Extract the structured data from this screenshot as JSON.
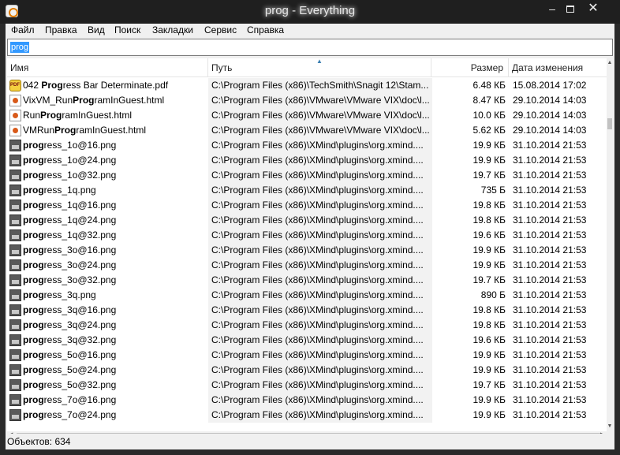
{
  "window": {
    "title": "prog - Everything",
    "minimize": "–",
    "close": "✕"
  },
  "menu": [
    "Файл",
    "Правка",
    "Вид",
    "Поиск",
    "Закладки",
    "Сервис",
    "Справка"
  ],
  "search": {
    "value": "prog"
  },
  "columns": {
    "name": "Имя",
    "path": "Путь",
    "size": "Размер",
    "date": "Дата изменения"
  },
  "rows": [
    {
      "icon": "pdf-icon",
      "pre": "042 ",
      "hl": "Prog",
      "suf": "ress Bar Determinate.pdf",
      "path": "C:\\Program Files (x86)\\TechSmith\\Snagit 12\\Stam...",
      "size": "6.48 КБ",
      "date": "15.08.2014 17:02"
    },
    {
      "icon": "html-icon",
      "pre": "VixVM_Run",
      "hl": "Prog",
      "suf": "ramInGuest.html",
      "path": "C:\\Program Files (x86)\\VMware\\VMware VIX\\doc\\l...",
      "size": "8.47 КБ",
      "date": "29.10.2014 14:03"
    },
    {
      "icon": "html-icon",
      "pre": "Run",
      "hl": "Prog",
      "suf": "ramInGuest.html",
      "path": "C:\\Program Files (x86)\\VMware\\VMware VIX\\doc\\l...",
      "size": "10.0 КБ",
      "date": "29.10.2014 14:03"
    },
    {
      "icon": "html-icon",
      "pre": "VMRun",
      "hl": "Prog",
      "suf": "ramInGuest.html",
      "path": "C:\\Program Files (x86)\\VMware\\VMware VIX\\doc\\l...",
      "size": "5.62 КБ",
      "date": "29.10.2014 14:03"
    },
    {
      "icon": "png-icon",
      "pre": "",
      "hl": "prog",
      "suf": "ress_1o@16.png",
      "path": "C:\\Program Files (x86)\\XMind\\plugins\\org.xmind....",
      "size": "19.9 КБ",
      "date": "31.10.2014 21:53"
    },
    {
      "icon": "png-icon",
      "pre": "",
      "hl": "prog",
      "suf": "ress_1o@24.png",
      "path": "C:\\Program Files (x86)\\XMind\\plugins\\org.xmind....",
      "size": "19.9 КБ",
      "date": "31.10.2014 21:53"
    },
    {
      "icon": "png-icon",
      "pre": "",
      "hl": "prog",
      "suf": "ress_1o@32.png",
      "path": "C:\\Program Files (x86)\\XMind\\plugins\\org.xmind....",
      "size": "19.7 КБ",
      "date": "31.10.2014 21:53"
    },
    {
      "icon": "png-icon",
      "pre": "",
      "hl": "prog",
      "suf": "ress_1q.png",
      "path": "C:\\Program Files (x86)\\XMind\\plugins\\org.xmind....",
      "size": "735 Б",
      "date": "31.10.2014 21:53"
    },
    {
      "icon": "png-icon",
      "pre": "",
      "hl": "prog",
      "suf": "ress_1q@16.png",
      "path": "C:\\Program Files (x86)\\XMind\\plugins\\org.xmind....",
      "size": "19.8 КБ",
      "date": "31.10.2014 21:53"
    },
    {
      "icon": "png-icon",
      "pre": "",
      "hl": "prog",
      "suf": "ress_1q@24.png",
      "path": "C:\\Program Files (x86)\\XMind\\plugins\\org.xmind....",
      "size": "19.8 КБ",
      "date": "31.10.2014 21:53"
    },
    {
      "icon": "png-icon",
      "pre": "",
      "hl": "prog",
      "suf": "ress_1q@32.png",
      "path": "C:\\Program Files (x86)\\XMind\\plugins\\org.xmind....",
      "size": "19.6 КБ",
      "date": "31.10.2014 21:53"
    },
    {
      "icon": "png-icon",
      "pre": "",
      "hl": "prog",
      "suf": "ress_3o@16.png",
      "path": "C:\\Program Files (x86)\\XMind\\plugins\\org.xmind....",
      "size": "19.9 КБ",
      "date": "31.10.2014 21:53"
    },
    {
      "icon": "png-icon",
      "pre": "",
      "hl": "prog",
      "suf": "ress_3o@24.png",
      "path": "C:\\Program Files (x86)\\XMind\\plugins\\org.xmind....",
      "size": "19.9 КБ",
      "date": "31.10.2014 21:53"
    },
    {
      "icon": "png-icon",
      "pre": "",
      "hl": "prog",
      "suf": "ress_3o@32.png",
      "path": "C:\\Program Files (x86)\\XMind\\plugins\\org.xmind....",
      "size": "19.7 КБ",
      "date": "31.10.2014 21:53"
    },
    {
      "icon": "png-icon",
      "pre": "",
      "hl": "prog",
      "suf": "ress_3q.png",
      "path": "C:\\Program Files (x86)\\XMind\\plugins\\org.xmind....",
      "size": "890 Б",
      "date": "31.10.2014 21:53"
    },
    {
      "icon": "png-icon",
      "pre": "",
      "hl": "prog",
      "suf": "ress_3q@16.png",
      "path": "C:\\Program Files (x86)\\XMind\\plugins\\org.xmind....",
      "size": "19.8 КБ",
      "date": "31.10.2014 21:53"
    },
    {
      "icon": "png-icon",
      "pre": "",
      "hl": "prog",
      "suf": "ress_3q@24.png",
      "path": "C:\\Program Files (x86)\\XMind\\plugins\\org.xmind....",
      "size": "19.8 КБ",
      "date": "31.10.2014 21:53"
    },
    {
      "icon": "png-icon",
      "pre": "",
      "hl": "prog",
      "suf": "ress_3q@32.png",
      "path": "C:\\Program Files (x86)\\XMind\\plugins\\org.xmind....",
      "size": "19.6 КБ",
      "date": "31.10.2014 21:53"
    },
    {
      "icon": "png-icon",
      "pre": "",
      "hl": "prog",
      "suf": "ress_5o@16.png",
      "path": "C:\\Program Files (x86)\\XMind\\plugins\\org.xmind....",
      "size": "19.9 КБ",
      "date": "31.10.2014 21:53"
    },
    {
      "icon": "png-icon",
      "pre": "",
      "hl": "prog",
      "suf": "ress_5o@24.png",
      "path": "C:\\Program Files (x86)\\XMind\\plugins\\org.xmind....",
      "size": "19.9 КБ",
      "date": "31.10.2014 21:53"
    },
    {
      "icon": "png-icon",
      "pre": "",
      "hl": "prog",
      "suf": "ress_5o@32.png",
      "path": "C:\\Program Files (x86)\\XMind\\plugins\\org.xmind....",
      "size": "19.7 КБ",
      "date": "31.10.2014 21:53"
    },
    {
      "icon": "png-icon",
      "pre": "",
      "hl": "prog",
      "suf": "ress_7o@16.png",
      "path": "C:\\Program Files (x86)\\XMind\\plugins\\org.xmind....",
      "size": "19.9 КБ",
      "date": "31.10.2014 21:53"
    },
    {
      "icon": "png-icon",
      "pre": "",
      "hl": "prog",
      "suf": "ress_7o@24.png",
      "path": "C:\\Program Files (x86)\\XMind\\plugins\\org.xmind....",
      "size": "19.9 КБ",
      "date": "31.10.2014 21:53"
    }
  ],
  "status": {
    "text": "Объектов: 634"
  },
  "colors": {
    "selection": "#3399ff",
    "titlebar": "#1f1f1f",
    "path_shade": "#f2f2f2"
  }
}
